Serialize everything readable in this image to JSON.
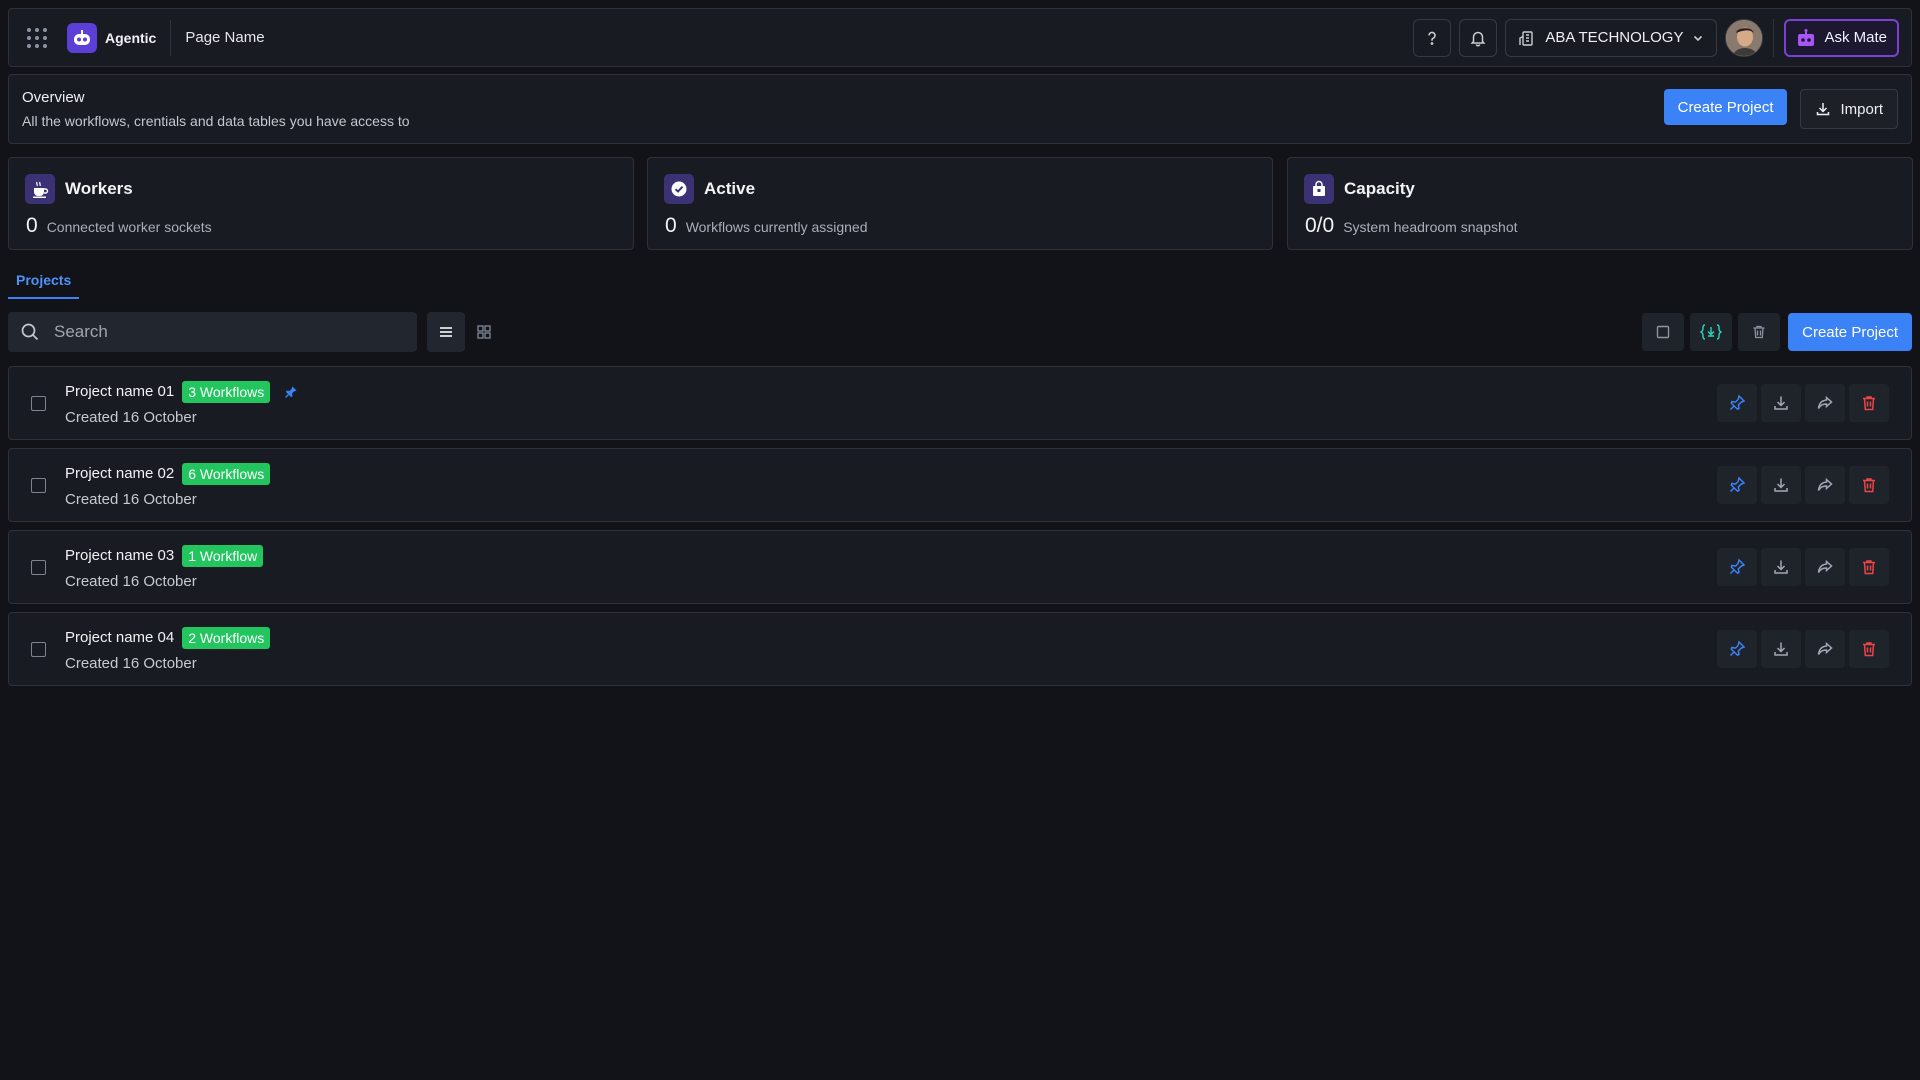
{
  "header": {
    "brand": "Agentic",
    "page_name": "Page Name",
    "org_name": "ABA TECHNOLOGY",
    "ask_label": "Ask Mate"
  },
  "overview": {
    "title": "Overview",
    "subtitle": "All the workflows, crentials and data tables you have access to",
    "create_label": "Create Project",
    "import_label": "Import"
  },
  "stats": [
    {
      "title": "Workers",
      "value": "0",
      "desc": "Connected worker sockets",
      "icon": "worker-icon"
    },
    {
      "title": "Active",
      "value": "0",
      "desc": "Workflows currently assigned",
      "icon": "check-circle-icon"
    },
    {
      "title": "Capacity",
      "value": "0/0",
      "desc": "System headroom snapshot",
      "icon": "capacity-icon"
    }
  ],
  "tabs": {
    "projects": "Projects"
  },
  "toolbar": {
    "search_placeholder": "Search",
    "create_label": "Create Project"
  },
  "projects": [
    {
      "name": "Project name 01",
      "badge": "3 Workflows",
      "created": "Created 16 October",
      "pinned": true
    },
    {
      "name": "Project name 02",
      "badge": "6 Workflows",
      "created": "Created 16 October",
      "pinned": false
    },
    {
      "name": "Project name 03",
      "badge": "1 Workflow",
      "created": "Created 16 October",
      "pinned": false
    },
    {
      "name": "Project name 04",
      "badge": "2 Workflows",
      "created": "Created 16 October",
      "pinned": false
    }
  ],
  "colors": {
    "accent": "#3b82f6",
    "badge": "#22c55e",
    "danger": "#ef4444",
    "brand": "#5b3fd6"
  }
}
